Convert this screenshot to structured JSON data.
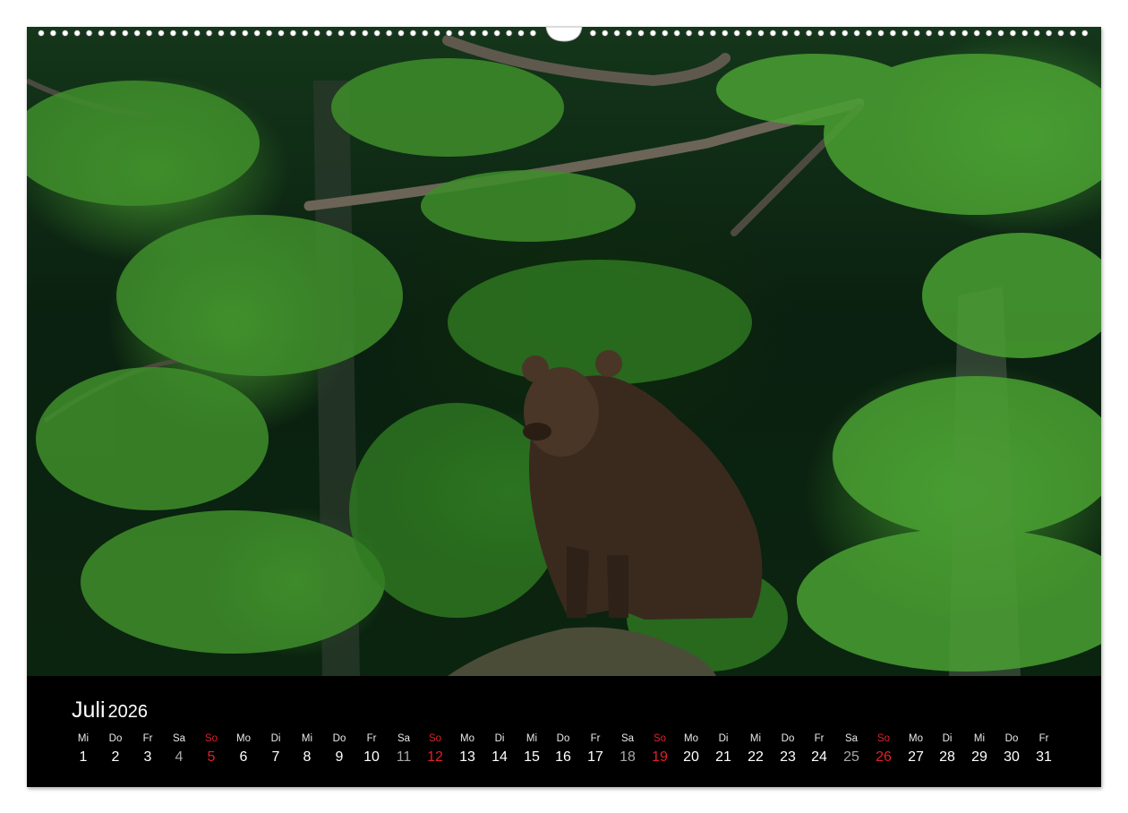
{
  "calendar": {
    "month": "Juli",
    "year": "2026",
    "days": [
      {
        "dow": "Mi",
        "day": "1",
        "kind": "weekday"
      },
      {
        "dow": "Do",
        "day": "2",
        "kind": "weekday"
      },
      {
        "dow": "Fr",
        "day": "3",
        "kind": "weekday"
      },
      {
        "dow": "Sa",
        "day": "4",
        "kind": "saturday"
      },
      {
        "dow": "So",
        "day": "5",
        "kind": "sunday"
      },
      {
        "dow": "Mo",
        "day": "6",
        "kind": "weekday"
      },
      {
        "dow": "Di",
        "day": "7",
        "kind": "weekday"
      },
      {
        "dow": "Mi",
        "day": "8",
        "kind": "weekday"
      },
      {
        "dow": "Do",
        "day": "9",
        "kind": "weekday"
      },
      {
        "dow": "Fr",
        "day": "10",
        "kind": "weekday"
      },
      {
        "dow": "Sa",
        "day": "11",
        "kind": "saturday"
      },
      {
        "dow": "So",
        "day": "12",
        "kind": "sunday"
      },
      {
        "dow": "Mo",
        "day": "13",
        "kind": "weekday"
      },
      {
        "dow": "Di",
        "day": "14",
        "kind": "weekday"
      },
      {
        "dow": "Mi",
        "day": "15",
        "kind": "weekday"
      },
      {
        "dow": "Do",
        "day": "16",
        "kind": "weekday"
      },
      {
        "dow": "Fr",
        "day": "17",
        "kind": "weekday"
      },
      {
        "dow": "Sa",
        "day": "18",
        "kind": "saturday"
      },
      {
        "dow": "So",
        "day": "19",
        "kind": "sunday"
      },
      {
        "dow": "Mo",
        "day": "20",
        "kind": "weekday"
      },
      {
        "dow": "Di",
        "day": "21",
        "kind": "weekday"
      },
      {
        "dow": "Mi",
        "day": "22",
        "kind": "weekday"
      },
      {
        "dow": "Do",
        "day": "23",
        "kind": "weekday"
      },
      {
        "dow": "Fr",
        "day": "24",
        "kind": "weekday"
      },
      {
        "dow": "Sa",
        "day": "25",
        "kind": "saturday"
      },
      {
        "dow": "So",
        "day": "26",
        "kind": "sunday"
      },
      {
        "dow": "Mo",
        "day": "27",
        "kind": "weekday"
      },
      {
        "dow": "Di",
        "day": "28",
        "kind": "weekday"
      },
      {
        "dow": "Mi",
        "day": "29",
        "kind": "weekday"
      },
      {
        "dow": "Do",
        "day": "30",
        "kind": "weekday"
      },
      {
        "dow": "Fr",
        "day": "31",
        "kind": "weekday"
      }
    ],
    "colors": {
      "weekday": "#ffffff",
      "saturday": "#a8a8a8",
      "sunday": "#e0202a",
      "bar_background": "#000000"
    }
  },
  "photo": {
    "subject": "brown bear in green forest",
    "colors": {
      "foliage": "#3e8f2c",
      "shadow": "#0a2010",
      "bear": "#3a2a1e"
    }
  },
  "binding": {
    "icon": "wire-binding-icon"
  }
}
